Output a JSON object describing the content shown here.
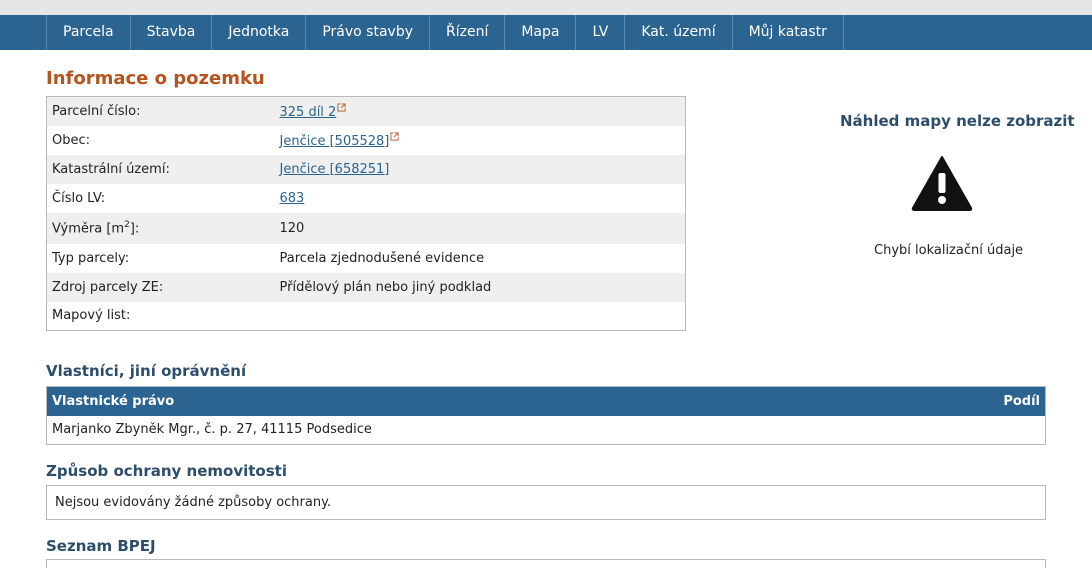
{
  "nav": {
    "tabs": [
      "Parcela",
      "Stavba",
      "Jednotka",
      "Právo stavby",
      "Řízení",
      "Mapa",
      "LV",
      "Kat. území",
      "Můj katastr"
    ]
  },
  "info": {
    "heading": "Informace o pozemku",
    "rows": {
      "parcelni_cislo": {
        "label": "Parcelní číslo:",
        "value": "325 díl 2"
      },
      "obec": {
        "label": "Obec:",
        "value": "Jenčice [505528]"
      },
      "katastralni_uzemi": {
        "label": "Katastrální území:",
        "value": "Jenčice [658251]"
      },
      "cislo_lv": {
        "label": "Číslo LV:",
        "value": "683"
      },
      "vymera": {
        "label_prefix": "Výměra [m",
        "label_sup": "2",
        "label_suffix": "]:",
        "value": "120"
      },
      "typ_parcely": {
        "label": "Typ parcely:",
        "value": "Parcela zjednodušené evidence"
      },
      "zdroj": {
        "label": "Zdroj parcely ZE:",
        "value": "Přídělový plán nebo jiný podklad"
      },
      "mapovy_list": {
        "label": "Mapový list:",
        "value": ""
      }
    }
  },
  "map_preview": {
    "title": "Náhled mapy nelze zobrazit",
    "message": "Chybí lokalizační údaje",
    "icon": "warning-icon"
  },
  "owners": {
    "heading": "Vlastníci, jiní oprávnění",
    "col_right": "Vlastnické právo",
    "col_share": "Podíl",
    "rows": [
      {
        "name": "Marjanko Zbyněk Mgr., č. p. 27, 41115 Podsedice",
        "share": ""
      }
    ]
  },
  "protection": {
    "heading": "Způsob ochrany nemovitosti",
    "text": "Nejsou evidovány žádné způsoby ochrany."
  },
  "bpej": {
    "heading": "Seznam BPEJ"
  },
  "colors": {
    "nav_bg": "#2b6491",
    "heading_orange": "#b4541f",
    "heading_blue": "#2d4e6b",
    "link": "#2b6491"
  }
}
